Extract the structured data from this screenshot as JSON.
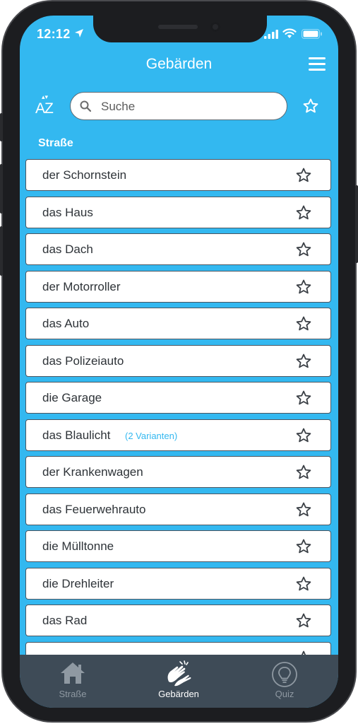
{
  "status_bar": {
    "time": "12:12"
  },
  "app_bar": {
    "title": "Gebärden"
  },
  "search": {
    "placeholder": "Suche",
    "value": ""
  },
  "sort_button": {
    "top_letter": "A",
    "bottom_letter": "Z"
  },
  "section_title": "Straße",
  "items": [
    {
      "label": "der Schornstein",
      "variant": ""
    },
    {
      "label": "das Haus",
      "variant": ""
    },
    {
      "label": "das Dach",
      "variant": ""
    },
    {
      "label": "der Motorroller",
      "variant": ""
    },
    {
      "label": "das Auto",
      "variant": ""
    },
    {
      "label": "das Polizeiauto",
      "variant": ""
    },
    {
      "label": "die Garage",
      "variant": ""
    },
    {
      "label": "das Blaulicht",
      "variant": "(2 Varianten)"
    },
    {
      "label": "der Krankenwagen",
      "variant": ""
    },
    {
      "label": "das Feuerwehrauto",
      "variant": ""
    },
    {
      "label": "die Mülltonne",
      "variant": ""
    },
    {
      "label": "die Drehleiter",
      "variant": ""
    },
    {
      "label": "das Rad",
      "variant": ""
    },
    {
      "label": "",
      "variant": ""
    }
  ],
  "tabs": [
    {
      "label": "Straße",
      "icon": "house-icon",
      "active": false
    },
    {
      "label": "Gebärden",
      "icon": "signing-hands-icon",
      "active": true
    },
    {
      "label": "Quiz",
      "icon": "lightbulb-icon",
      "active": false
    }
  ],
  "colors": {
    "primary": "#33b8f0",
    "tabbar": "#3e4b57",
    "item_text": "#2e3338",
    "variant_text": "#33b8f0"
  }
}
